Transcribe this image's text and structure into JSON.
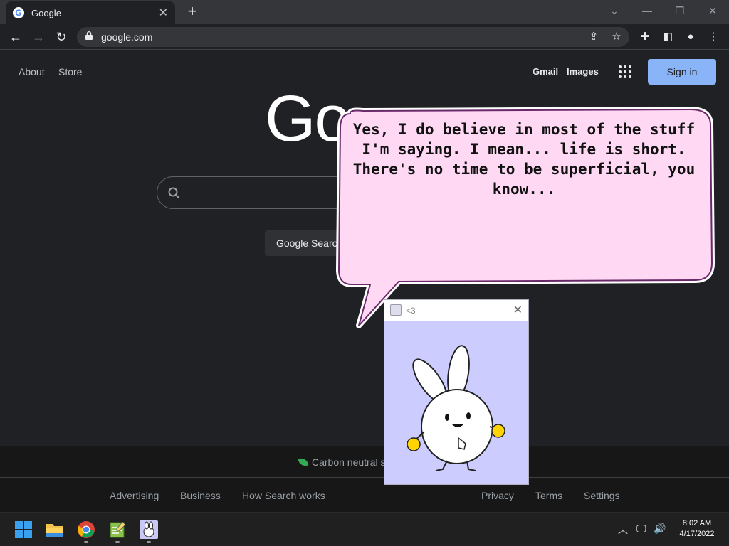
{
  "browser": {
    "tab": {
      "title": "Google",
      "favicon": "google-g-icon"
    },
    "url": "google.com"
  },
  "google": {
    "logo_visible": "Go",
    "top_left_links": [
      "About",
      "Store"
    ],
    "top_right_links": [
      "Gmail",
      "Images"
    ],
    "signin_label": "Sign in",
    "search_button_label": "Google Search",
    "carbon_text": "Carbon neutral s",
    "footer_left": [
      "Advertising",
      "Business",
      "How Search works"
    ],
    "footer_right": [
      "Privacy",
      "Terms",
      "Settings"
    ]
  },
  "bubble": {
    "text": "Yes, I do believe in most of the stuff I'm saying. I mean... life is short. There's no time to be superficial, you know..."
  },
  "pet_window": {
    "title": "<3",
    "background_color": "#ccccff"
  },
  "taskbar": {
    "apps": [
      "start-icon",
      "file-explorer-icon",
      "chrome-icon",
      "notepad-icon",
      "pet-app-icon"
    ],
    "clock_time": "8:02 AM",
    "clock_date": "4/17/2022"
  },
  "colors": {
    "page_bg": "#202124",
    "signin_bg": "#8ab4f8",
    "bubble_fill": "#ffd9f4",
    "bubble_stroke": "#7a2f7a"
  }
}
